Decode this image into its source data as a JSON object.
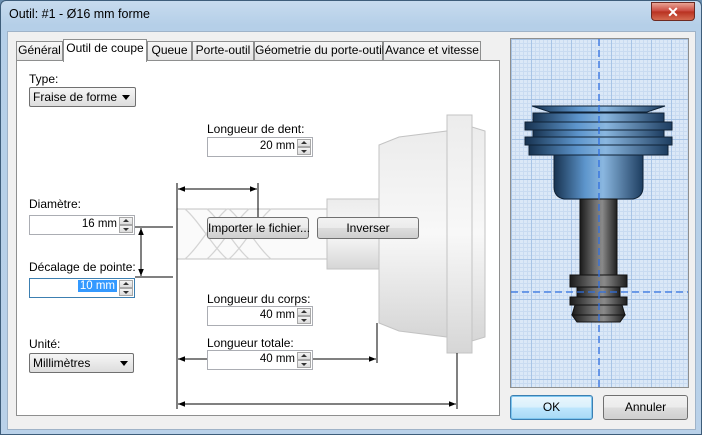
{
  "window": {
    "title": "Outil: #1 - Ø16 mm forme",
    "close_glyph": "✕"
  },
  "tabs": [
    {
      "label": "Général",
      "active": false
    },
    {
      "label": "Outil de coupe",
      "active": true
    },
    {
      "label": "Queue",
      "active": false
    },
    {
      "label": "Porte-outil",
      "active": false
    },
    {
      "label": "Géometrie du porte-outil",
      "active": false
    },
    {
      "label": "Avance et vitesse",
      "active": false
    }
  ],
  "form": {
    "type_label": "Type:",
    "type_value": "Fraise de forme",
    "diametre_label": "Diamètre:",
    "diametre_value": "16 mm",
    "decalage_label": "Décalage de pointe:",
    "decalage_value": "10 mm",
    "unite_label": "Unité:",
    "unite_value": "Millimètres",
    "longueur_dent_label": "Longueur de dent:",
    "longueur_dent_value": "20 mm",
    "longueur_corps_label": "Longueur du corps:",
    "longueur_corps_value": "40 mm",
    "longueur_totale_label": "Longueur totale:",
    "longueur_totale_value": "40 mm"
  },
  "buttons": {
    "importer": "Importer le fichier...",
    "inverser": "Inverser",
    "ok": "OK",
    "annuler": "Annuler"
  },
  "colors": {
    "accent_blue": "#3399ff",
    "tool_blue": "#4d86c0",
    "dim_line": "#000000"
  }
}
